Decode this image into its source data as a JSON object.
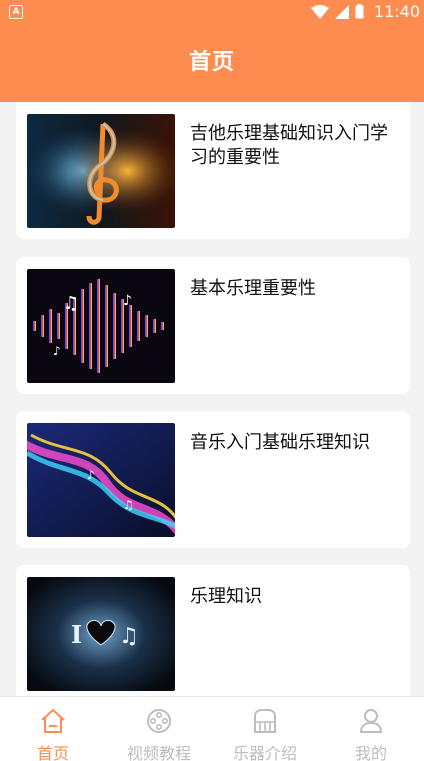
{
  "status_bar": {
    "time": "11:40",
    "app_badge": "A"
  },
  "header": {
    "title": "首页"
  },
  "articles": [
    {
      "title": "吉他乐理基础知识入门学习的重要性",
      "image": "treble-clef-fire-water"
    },
    {
      "title": "基本乐理重要性",
      "image": "neon-music-notes-equalizer"
    },
    {
      "title": "音乐入门基础乐理知识",
      "image": "colorful-music-swirl"
    },
    {
      "title": "乐理知识",
      "image": "i-love-music-glow"
    }
  ],
  "tabs": [
    {
      "label": "首页",
      "icon": "home-icon",
      "active": true
    },
    {
      "label": "视频教程",
      "icon": "film-reel-icon",
      "active": false
    },
    {
      "label": "乐器介绍",
      "icon": "piano-icon",
      "active": false
    },
    {
      "label": "我的",
      "icon": "user-icon",
      "active": false
    }
  ],
  "colors": {
    "accent": "#ff8c4f",
    "inactive": "#bdbdbd",
    "background": "#f3f3f3"
  }
}
